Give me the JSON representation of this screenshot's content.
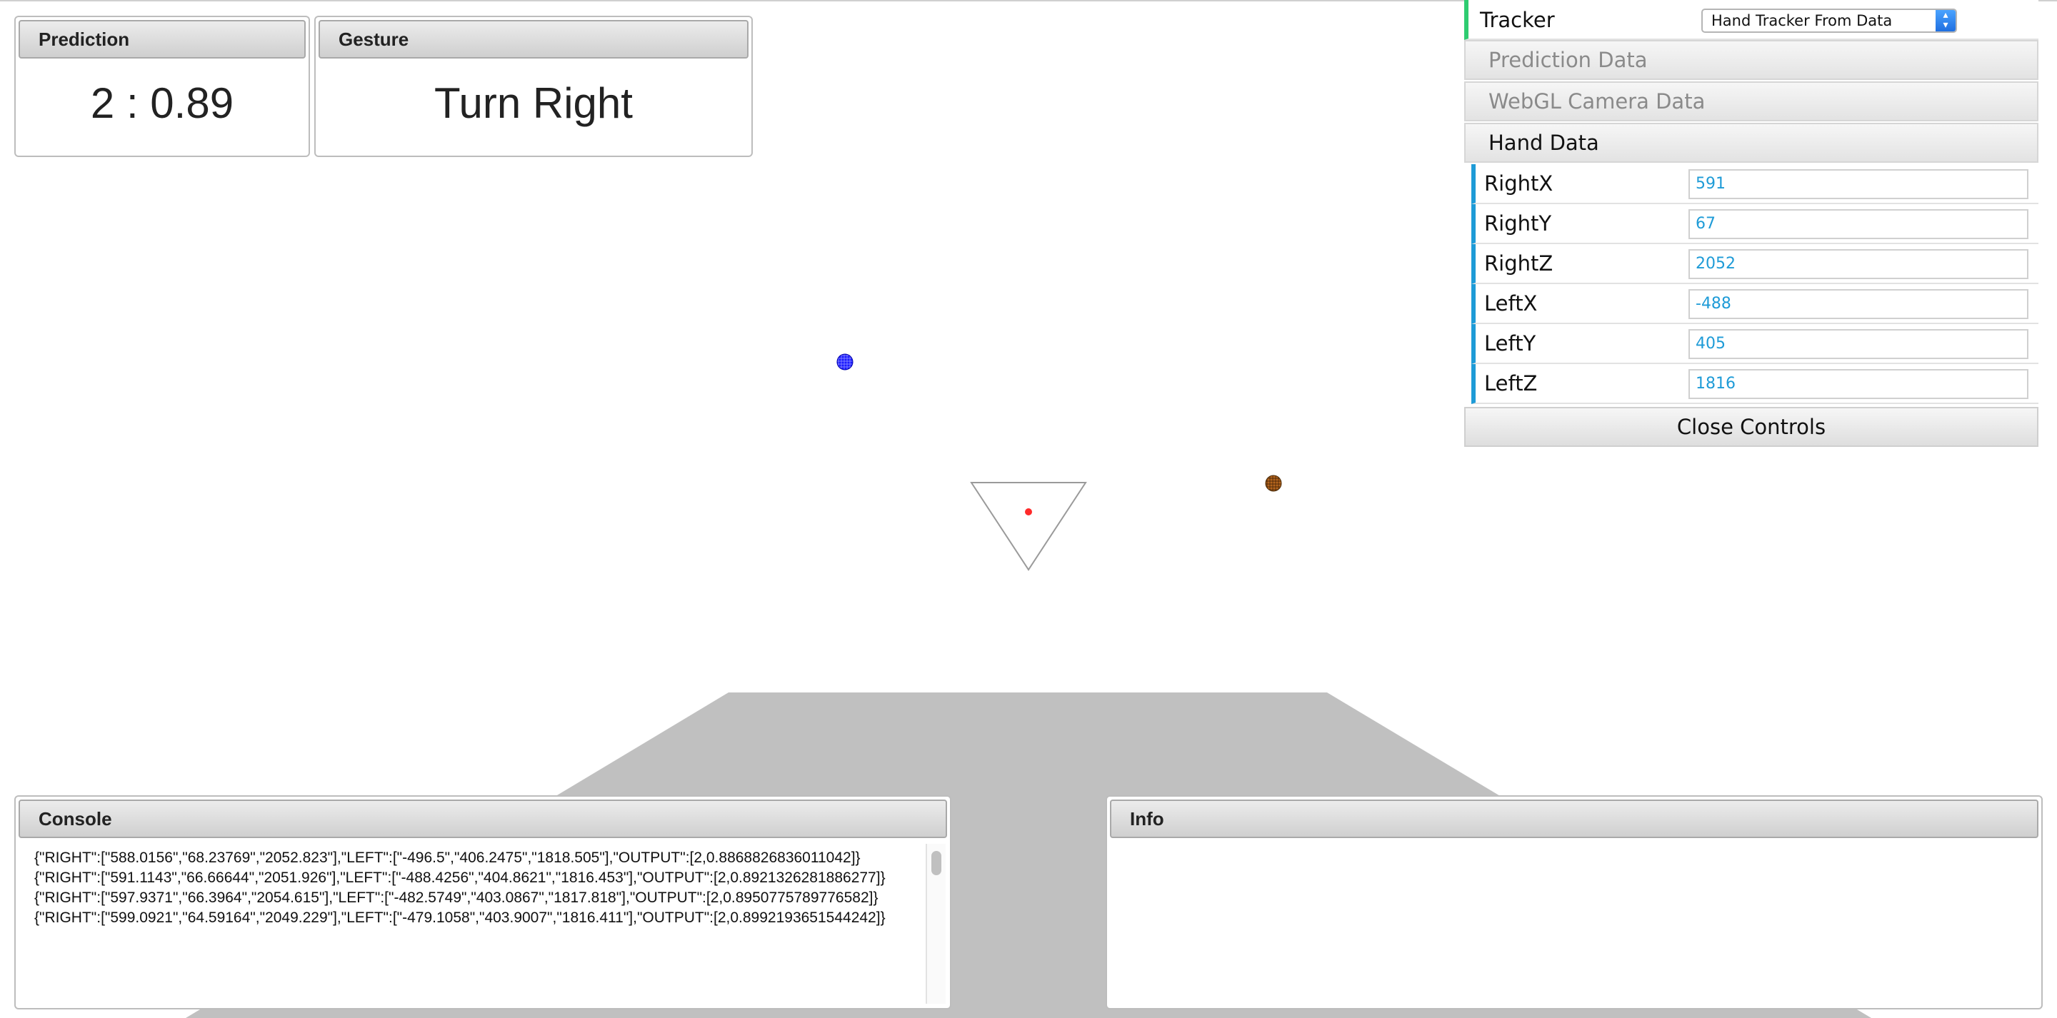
{
  "prediction_panel": {
    "title": "Prediction",
    "value": "2 : 0.89"
  },
  "gesture_panel": {
    "title": "Gesture",
    "value": "Turn Right"
  },
  "controls": {
    "tracker_label": "Tracker",
    "tracker_selected": "Hand Tracker From Data",
    "folders": {
      "prediction": "Prediction Data",
      "webgl": "WebGL Camera Data",
      "hand": "Hand Data"
    },
    "hand_data": [
      {
        "label": "RightX",
        "value": "591"
      },
      {
        "label": "RightY",
        "value": "67"
      },
      {
        "label": "RightZ",
        "value": "2052"
      },
      {
        "label": "LeftX",
        "value": "-488"
      },
      {
        "label": "LeftY",
        "value": "405"
      },
      {
        "label": "LeftZ",
        "value": "1816"
      }
    ],
    "close_label": "Close Controls"
  },
  "console_panel": {
    "title": "Console",
    "lines": [
      "{\"RIGHT\":[\"588.0156\",\"68.23769\",\"2052.823\"],\"LEFT\":[\"-496.5\",\"406.2475\",\"1818.505\"],\"OUTPUT\":[2,0.8868826836011042]}",
      "{\"RIGHT\":[\"591.1143\",\"66.66644\",\"2051.926\"],\"LEFT\":[\"-488.4256\",\"404.8621\",\"1816.453\"],\"OUTPUT\":[2,0.8921326281886277]}",
      "{\"RIGHT\":[\"597.9371\",\"66.3964\",\"2054.615\"],\"LEFT\":[\"-482.5749\",\"403.0867\",\"1817.818\"],\"OUTPUT\":[2,0.8950775789776582]}",
      "{\"RIGHT\":[\"599.0921\",\"64.59164\",\"2049.229\"],\"LEFT\":[\"-479.1058\",\"403.9007\",\"1816.411\"],\"OUTPUT\":[2,0.8992193651544242]}"
    ]
  },
  "info_panel": {
    "title": "Info"
  },
  "colors": {
    "right_hand_sphere": "#1a1aff",
    "left_hand_sphere": "#b5651d",
    "camera_point": "#ff2a2a",
    "floor": "#c0c0c0",
    "tracker_accent": "#2ecc71",
    "number_accent": "#1e9bd7"
  }
}
